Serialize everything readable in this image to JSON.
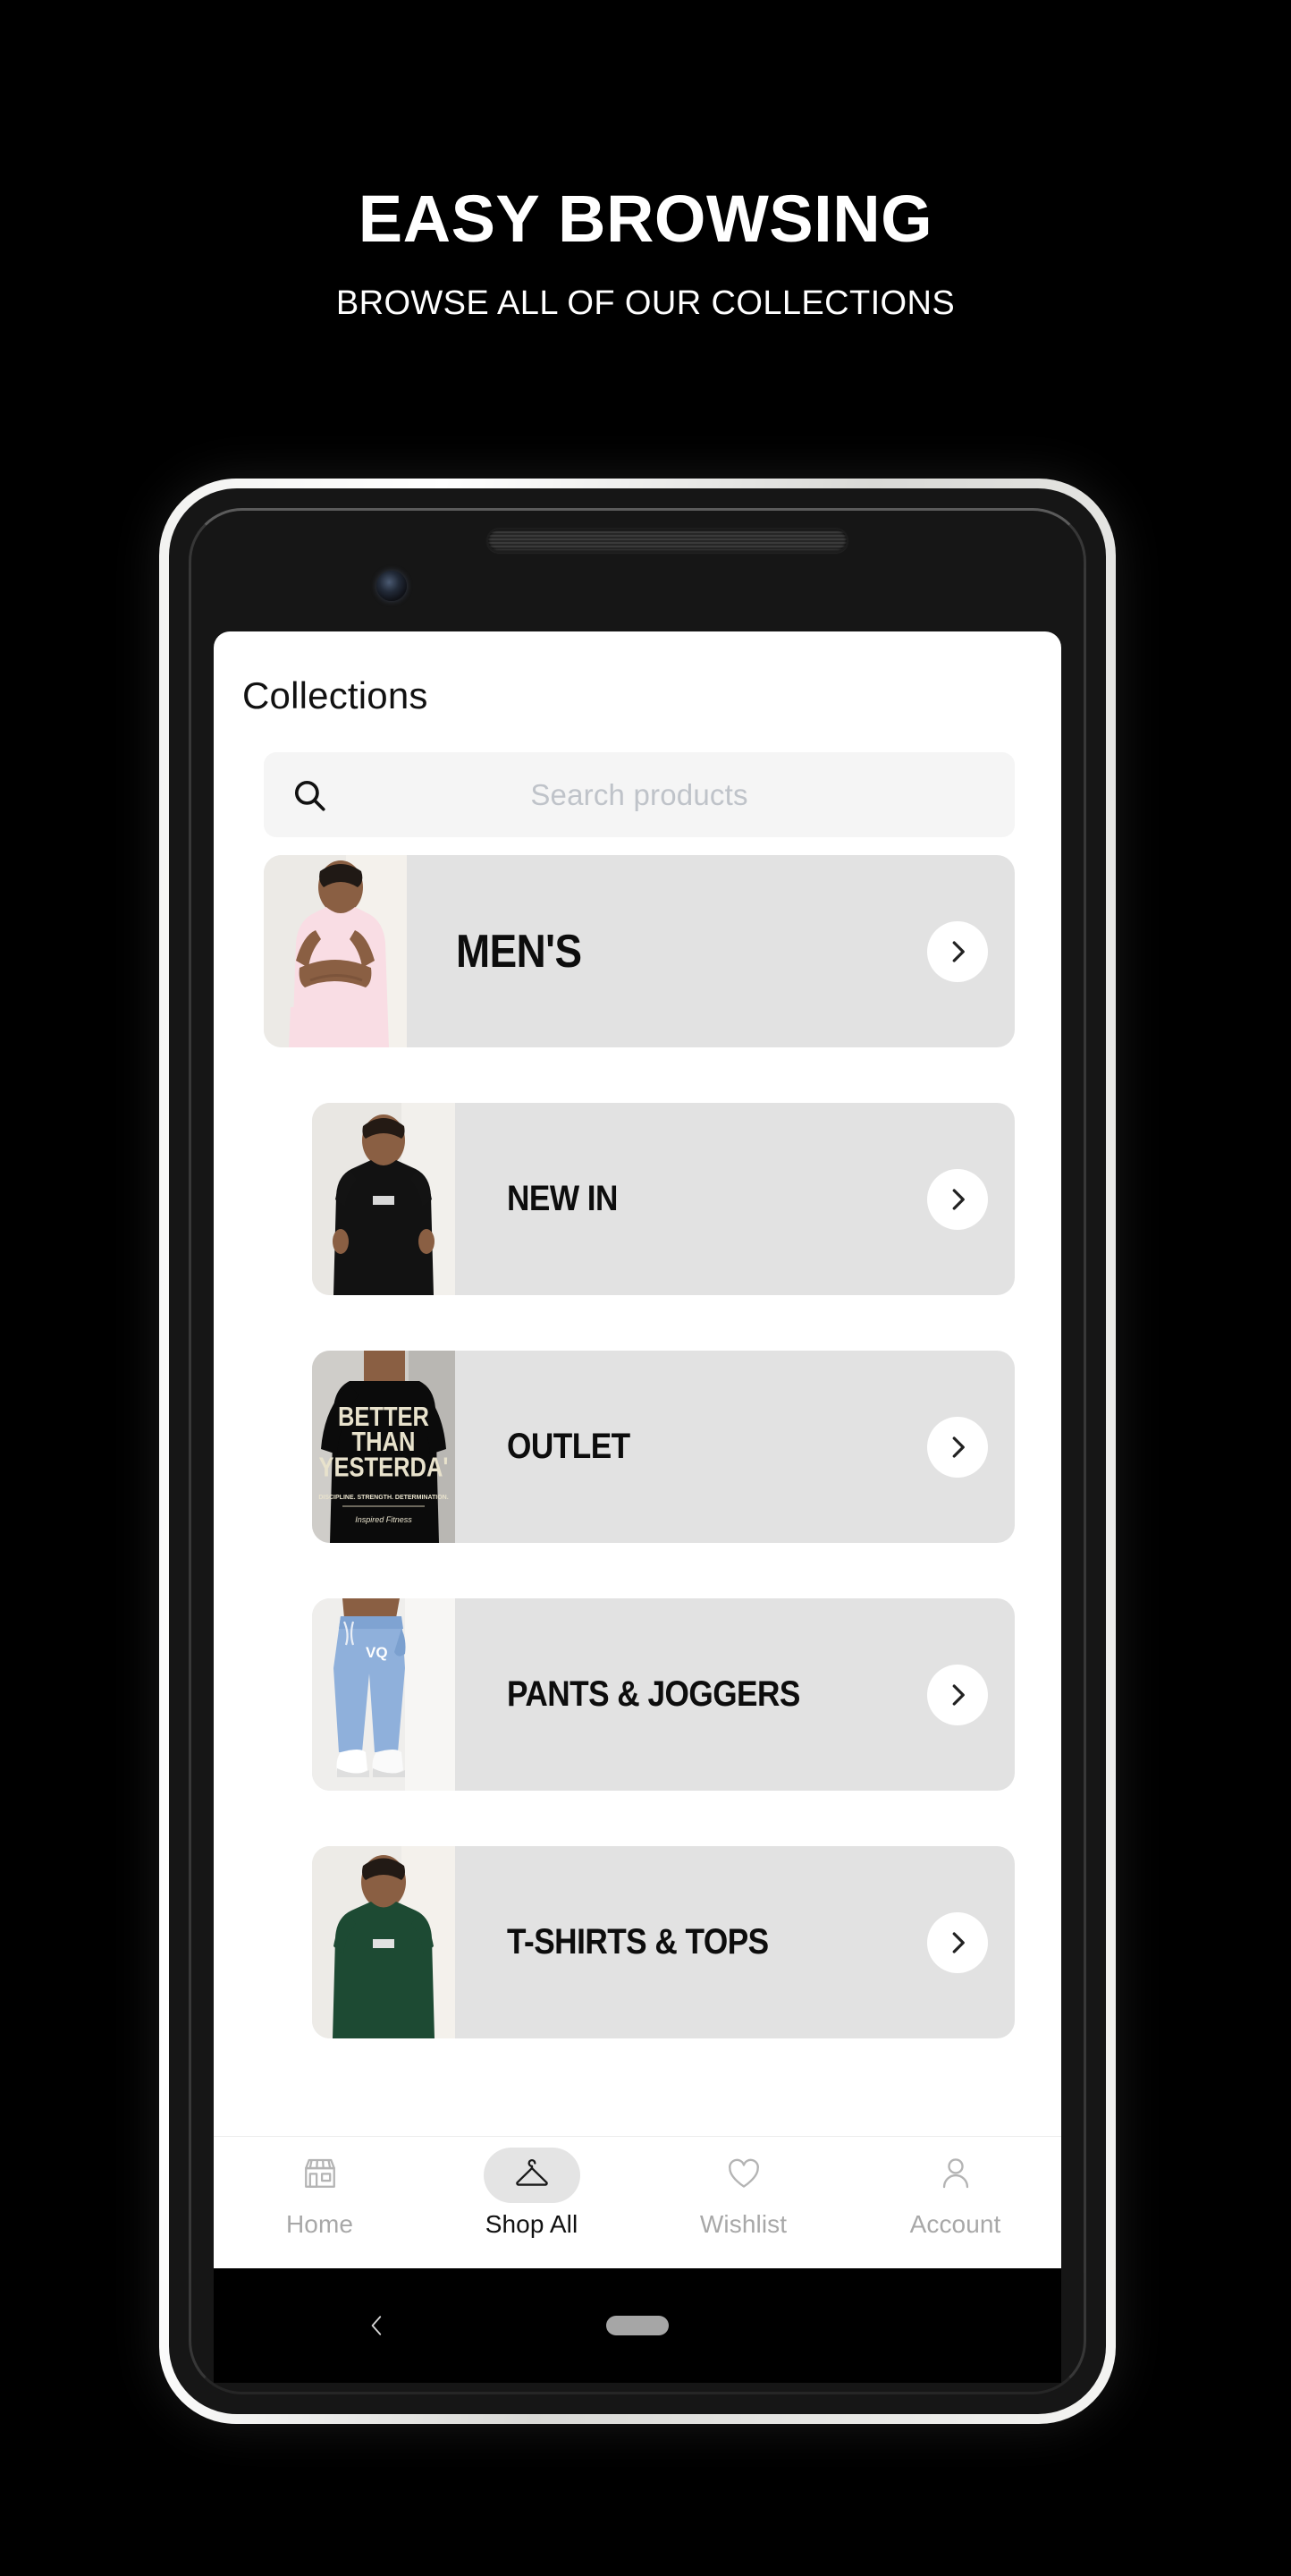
{
  "promo": {
    "title": "EASY BROWSING",
    "subtitle": "BROWSE ALL OF OUR COLLECTIONS"
  },
  "app": {
    "title": "Collections",
    "search": {
      "placeholder": "Search products",
      "value": "",
      "icon": "search-icon"
    },
    "collections": [
      {
        "label": "MEN'S",
        "featured": true,
        "thumb": "man-pink-tshirt",
        "chevron": "chevron-right-icon"
      },
      {
        "label": "NEW IN",
        "featured": false,
        "thumb": "man-black-tshirt",
        "chevron": "chevron-right-icon"
      },
      {
        "label": "OUTLET",
        "featured": false,
        "thumb": "man-better-than-yesterday-tee",
        "chevron": "chevron-right-icon"
      },
      {
        "label": "PANTS & JOGGERS",
        "featured": false,
        "thumb": "man-blue-joggers",
        "chevron": "chevron-right-icon"
      },
      {
        "label": "T-SHIRTS & TOPS",
        "featured": false,
        "thumb": "man-green-tshirt",
        "chevron": "chevron-right-icon"
      }
    ],
    "tabs": [
      {
        "label": "Home",
        "icon": "storefront-icon",
        "active": false
      },
      {
        "label": "Shop All",
        "icon": "hanger-icon",
        "active": true
      },
      {
        "label": "Wishlist",
        "icon": "heart-icon",
        "active": false
      },
      {
        "label": "Account",
        "icon": "person-icon",
        "active": false
      }
    ]
  },
  "system_nav": {
    "back_icon": "chevron-left-icon",
    "home_pill": "home-pill-indicator"
  },
  "device": {
    "power_button_color": "#F2714C",
    "volume_button_color": "#E4E4E1",
    "frame_color": "#EFEFED",
    "screen_background": "#FFFFFF"
  },
  "colors": {
    "page_background": "#000000",
    "promo_text": "#FFFFFF",
    "row_background": "#E2E2E2",
    "search_background": "#F5F5F5",
    "placeholder_text": "#BFC3C9",
    "active_tab_text": "#111111",
    "inactive_tab_text": "#A8A8A8"
  }
}
